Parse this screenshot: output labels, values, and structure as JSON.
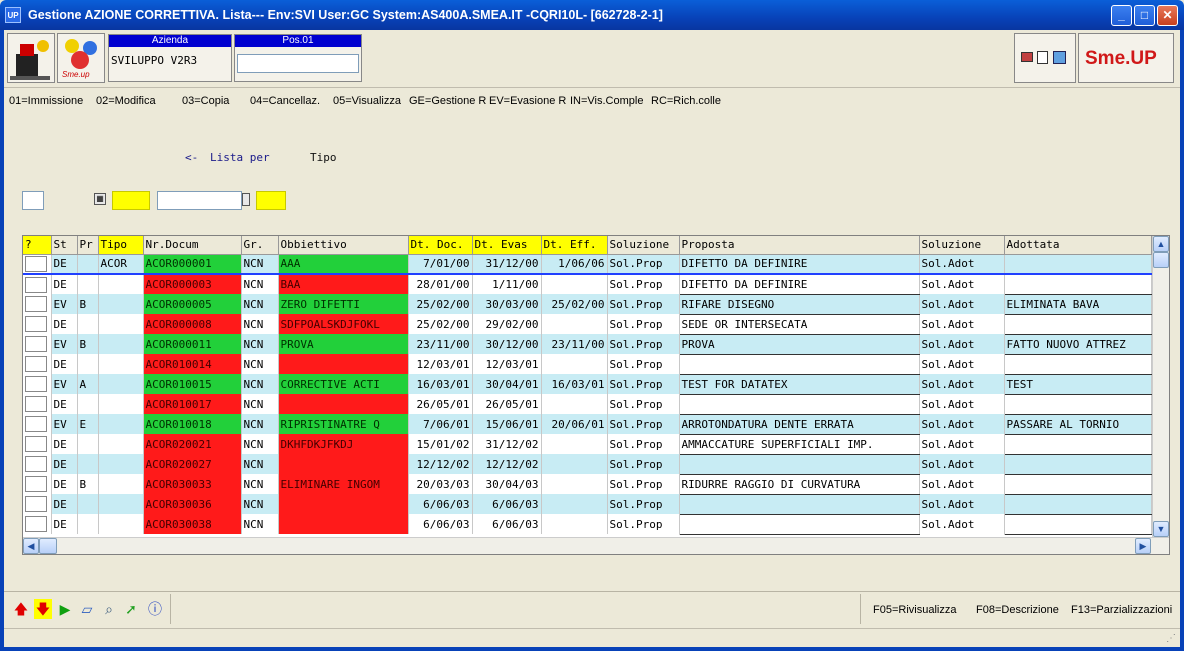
{
  "window": {
    "title": "Gestione AZIONE CORRETTIVA.  Lista--- Env:SVI User:GC System:AS400A.SMEA.IT -CQRI10L- [662728-2-1]",
    "app_icon": "UP"
  },
  "header": {
    "azienda_label": "Azienda",
    "azienda_value": "SVILUPPO V2R3",
    "pos_label": "Pos.01",
    "pos_value": "",
    "logo_text": "Sme.up",
    "brand": "Sme.UP",
    "brand_up": "UP"
  },
  "commands": [
    "01=Immissione",
    "02=Modifica",
    "03=Copia",
    "04=Cancellaz.",
    "05=Visualizza",
    "GE=Gestione R",
    "EV=Evasione R",
    "IN=Vis.Comple",
    "RC=Rich.colle"
  ],
  "lista": {
    "arrow": "<-",
    "label": "Lista per",
    "value": "Tipo"
  },
  "grid": {
    "columns": [
      "?",
      "St",
      "Pr",
      "Tipo",
      "Nr.Docum",
      "Gr.",
      "Obbiettivo",
      "Dt. Doc.",
      "Dt. Evas",
      "Dt. Eff.",
      "Soluzione",
      "Proposta",
      "Soluzione",
      "Adottata"
    ],
    "rows": [
      {
        "st": "DE",
        "pr": "",
        "tipo": "ACOR",
        "nr": "ACOR000001",
        "gr": "NCN",
        "obb": "AAA",
        "obbc": "green",
        "dtdoc": "7/01/00",
        "dtev": "31/12/00",
        "dteff": "1/06/06",
        "sol": "Sol.Prop",
        "prop": "DIFETTO DA DEFINIRE",
        "sol2": "Sol.Adot",
        "ado": ""
      },
      {
        "st": "DE",
        "pr": "",
        "tipo": "",
        "nr": "ACOR000003",
        "gr": "NCN",
        "obb": "BAA",
        "obbc": "red",
        "dtdoc": "28/01/00",
        "dtev": "1/11/00",
        "dteff": "",
        "sol": "Sol.Prop",
        "prop": "DIFETTO DA DEFINIRE",
        "sol2": "Sol.Adot",
        "ado": ""
      },
      {
        "st": "EV",
        "pr": "B",
        "tipo": "",
        "nr": "ACOR000005",
        "gr": "NCN",
        "obb": "ZERO DIFETTI",
        "obbc": "green",
        "dtdoc": "25/02/00",
        "dtev": "30/03/00",
        "dteff": "25/02/00",
        "sol": "Sol.Prop",
        "prop": "RIFARE DISEGNO",
        "sol2": "Sol.Adot",
        "ado": "ELIMINATA BAVA"
      },
      {
        "st": "DE",
        "pr": "",
        "tipo": "",
        "nr": "ACOR000008",
        "gr": "NCN",
        "obb": "SDFPOALSKDJFOKL",
        "obbc": "red",
        "dtdoc": "25/02/00",
        "dtev": "29/02/00",
        "dteff": "",
        "sol": "Sol.Prop",
        "prop": "SEDE OR INTERSECATA",
        "sol2": "Sol.Adot",
        "ado": ""
      },
      {
        "st": "EV",
        "pr": "B",
        "tipo": "",
        "nr": "ACOR000011",
        "gr": "NCN",
        "obb": "PROVA",
        "obbc": "green",
        "dtdoc": "23/11/00",
        "dtev": "30/12/00",
        "dteff": "23/11/00",
        "sol": "Sol.Prop",
        "prop": "PROVA",
        "sol2": "Sol.Adot",
        "ado": "FATTO NUOVO ATTREZ"
      },
      {
        "st": "DE",
        "pr": "",
        "tipo": "",
        "nr": "ACOR010014",
        "gr": "NCN",
        "obb": "",
        "obbc": "red",
        "dtdoc": "12/03/01",
        "dtev": "12/03/01",
        "dteff": "",
        "sol": "Sol.Prop",
        "prop": "",
        "sol2": "Sol.Adot",
        "ado": ""
      },
      {
        "st": "EV",
        "pr": "A",
        "tipo": "",
        "nr": "ACOR010015",
        "gr": "NCN",
        "obb": "CORRECTIVE ACTI",
        "obbc": "green",
        "dtdoc": "16/03/01",
        "dtev": "30/04/01",
        "dteff": "16/03/01",
        "sol": "Sol.Prop",
        "prop": "TEST FOR DATATEX",
        "sol2": "Sol.Adot",
        "ado": "TEST"
      },
      {
        "st": "DE",
        "pr": "",
        "tipo": "",
        "nr": "ACOR010017",
        "gr": "NCN",
        "obb": "",
        "obbc": "red",
        "dtdoc": "26/05/01",
        "dtev": "26/05/01",
        "dteff": "",
        "sol": "Sol.Prop",
        "prop": "",
        "sol2": "Sol.Adot",
        "ado": ""
      },
      {
        "st": "EV",
        "pr": "E",
        "tipo": "",
        "nr": "ACOR010018",
        "gr": "NCN",
        "obb": "RIPRISTINATRE Q",
        "obbc": "green",
        "dtdoc": "7/06/01",
        "dtev": "15/06/01",
        "dteff": "20/06/01",
        "sol": "Sol.Prop",
        "prop": "ARROTONDATURA DENTE ERRATA",
        "sol2": "Sol.Adot",
        "ado": "PASSARE AL TORNIO"
      },
      {
        "st": "DE",
        "pr": "",
        "tipo": "",
        "nr": "ACOR020021",
        "gr": "NCN",
        "obb": "DKHFDKJFKDJ",
        "obbc": "red",
        "dtdoc": "15/01/02",
        "dtev": "31/12/02",
        "dteff": "",
        "sol": "Sol.Prop",
        "prop": "AMMACCATURE SUPERFICIALI IMP.",
        "sol2": "Sol.Adot",
        "ado": ""
      },
      {
        "st": "DE",
        "pr": "",
        "tipo": "",
        "nr": "ACOR020027",
        "gr": "NCN",
        "obb": "",
        "obbc": "red",
        "dtdoc": "12/12/02",
        "dtev": "12/12/02",
        "dteff": "",
        "sol": "Sol.Prop",
        "prop": "",
        "sol2": "Sol.Adot",
        "ado": ""
      },
      {
        "st": "DE",
        "pr": "B",
        "tipo": "",
        "nr": "ACOR030033",
        "gr": "NCN",
        "obb": "ELIMINARE INGOM",
        "obbc": "red",
        "dtdoc": "20/03/03",
        "dtev": "30/04/03",
        "dteff": "",
        "sol": "Sol.Prop",
        "prop": "RIDURRE RAGGIO DI CURVATURA",
        "sol2": "Sol.Adot",
        "ado": ""
      },
      {
        "st": "DE",
        "pr": "",
        "tipo": "",
        "nr": "ACOR030036",
        "gr": "NCN",
        "obb": "",
        "obbc": "red",
        "dtdoc": "6/06/03",
        "dtev": "6/06/03",
        "dteff": "",
        "sol": "Sol.Prop",
        "prop": "",
        "sol2": "Sol.Adot",
        "ado": ""
      },
      {
        "st": "DE",
        "pr": "",
        "tipo": "",
        "nr": "ACOR030038",
        "gr": "NCN",
        "obb": "",
        "obbc": "red",
        "dtdoc": "6/06/03",
        "dtev": "6/06/03",
        "dteff": "",
        "sol": "Sol.Prop",
        "prop": "",
        "sol2": "Sol.Adot",
        "ado": ""
      }
    ]
  },
  "fkeys": [
    "F05=Rivisualizza",
    "F08=Descrizione",
    "F13=Parzializzazioni"
  ],
  "colors": {
    "title_bar": "#0842b8",
    "highlight": "#ffff00",
    "red_cell": "#ff1a1a",
    "green_cell": "#22d03a",
    "alt_row": "#c8ecf4"
  }
}
